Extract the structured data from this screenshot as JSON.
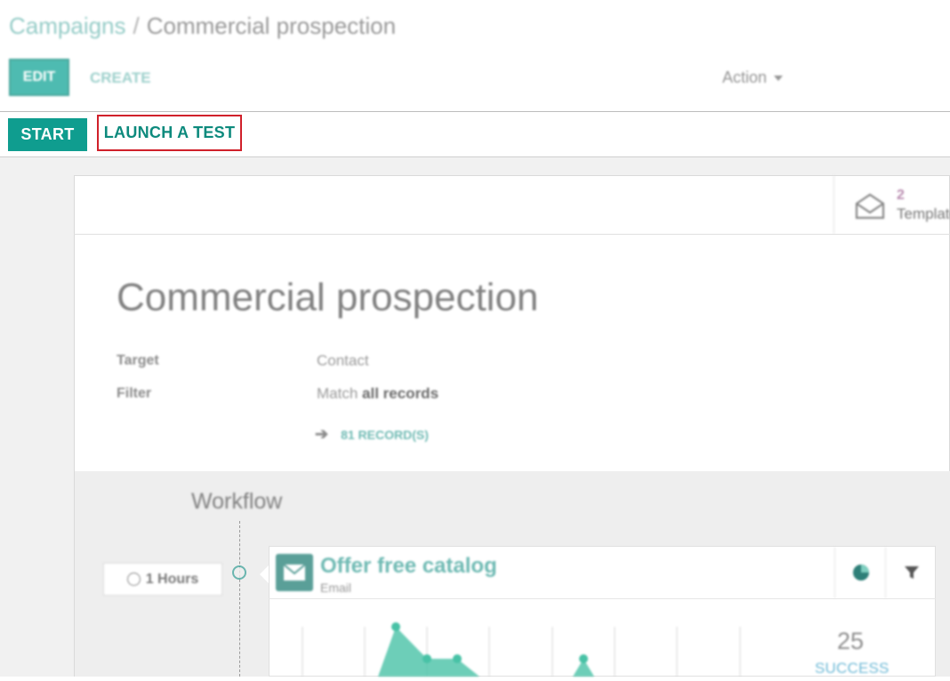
{
  "breadcrumb": {
    "parent": "Campaigns",
    "separator": "/",
    "current": "Commercial prospection"
  },
  "control_panel": {
    "edit_label": "EDIT",
    "create_label": "CREATE",
    "action_label": "Action"
  },
  "statusbar": {
    "start_label": "START",
    "launch_test_label": "LAUNCH A TEST"
  },
  "stat_button": {
    "count": "2",
    "label": "Templates",
    "icon": "envelope-open-icon"
  },
  "form": {
    "title": "Commercial prospection",
    "target_label": "Target",
    "target_value": "Contact",
    "filter_label": "Filter",
    "filter_prefix": "Match",
    "filter_value": "all records",
    "records_label": "81 RECORD(S)"
  },
  "workflow": {
    "title": "Workflow",
    "delay_label": "1 Hours",
    "activity": {
      "title": "Offer free catalog",
      "type": "Email",
      "icon": "envelope-icon",
      "tools": [
        "pie-chart-icon",
        "filter-icon"
      ],
      "kpi_value": "25",
      "kpi_label": "SUCCESS"
    }
  },
  "colors": {
    "primary": "#0f9d8f",
    "highlight_border": "#d0202a",
    "accent_green": "#3fa39a"
  }
}
